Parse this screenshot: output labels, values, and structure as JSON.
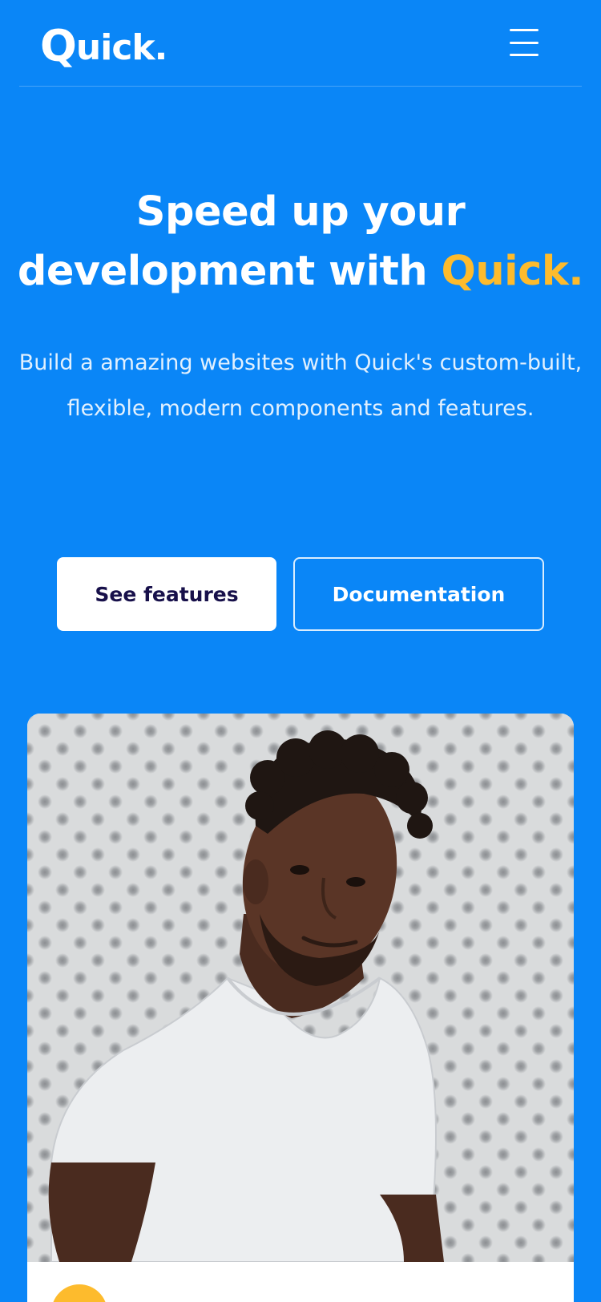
{
  "navbar": {
    "logo_letter": "Q",
    "logo_rest": "uick.",
    "menu_icon": "hamburger-menu-icon"
  },
  "hero": {
    "title_line1": "Speed up your",
    "title_line2_prefix": "development with ",
    "title_line2_accent": "Quick.",
    "subtitle": "Build a amazing websites with Quick's custom-built, flexible, modern components and features."
  },
  "buttons": {
    "features_label": "See features",
    "docs_label": "Documentation"
  },
  "colors": {
    "background": "#0a86f7",
    "accent": "#fdbb2d",
    "button_text_dark": "#17104a",
    "white": "#ffffff"
  },
  "card": {
    "image": "portrait-photo",
    "badge_icon": "yellow-circle-icon"
  }
}
